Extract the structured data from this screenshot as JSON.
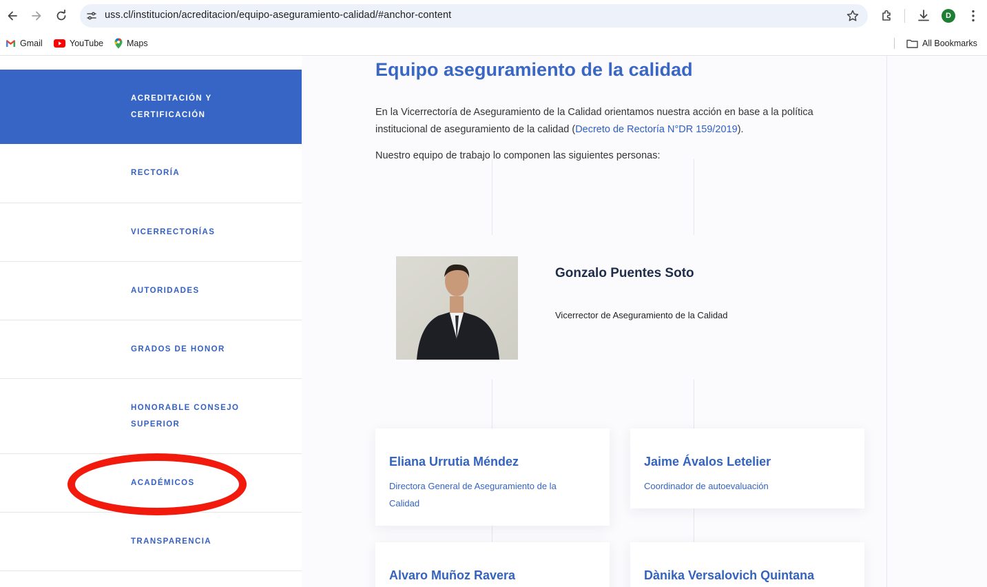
{
  "browser": {
    "url": "uss.cl/institucion/acreditacion/equipo-aseguramiento-calidad/#anchor-content",
    "profile_initial": "D",
    "bookmarks": [
      {
        "label": "Gmail",
        "icon": "gmail-icon"
      },
      {
        "label": "YouTube",
        "icon": "youtube-icon"
      },
      {
        "label": "Maps",
        "icon": "maps-icon"
      }
    ],
    "all_bookmarks_label": "All Bookmarks"
  },
  "sidebar": {
    "items": [
      {
        "label": "ACREDITACIÓN Y"
      },
      {
        "label": "CERTIFICACIÓN"
      },
      {
        "label": "RECTORÍA"
      },
      {
        "label": "VICERRECTORÍAS"
      },
      {
        "label": "AUTORIDADES"
      },
      {
        "label": "GRADOS DE HONOR"
      },
      {
        "label": "HONORABLE CONSEJO"
      },
      {
        "label": "SUPERIOR"
      },
      {
        "label": "ACADÉMICOS"
      },
      {
        "label": "TRANSPARENCIA"
      }
    ],
    "active_color": "#3665c5",
    "text_color": "#3561c2"
  },
  "main": {
    "title": "Equipo aseguramiento de la calidad",
    "intro_before_link": "En la Vicerrectoría de Aseguramiento de la Calidad orientamos nuestra acción en base a la política institucional de aseguramiento de la calidad (",
    "intro_link": "Decreto de Rectoría N°DR 159/2019",
    "intro_after_link": ").",
    "intro2": "Nuestro equipo de trabajo lo componen las siguientes personas:",
    "lead": {
      "name": "Gonzalo Puentes Soto",
      "role": "Vicerrector de Aseguramiento de la Calidad"
    },
    "team": [
      {
        "name": "Eliana Urrutia Méndez",
        "role": "Directora General de Aseguramiento de la Calidad"
      },
      {
        "name": "Jaime Ávalos Letelier",
        "role": "Coordinador de autoevaluación"
      },
      {
        "name": "Alvaro Muñoz Ravera",
        "role": ""
      },
      {
        "name": "Dànika Versalovich Quintana",
        "role": ""
      }
    ],
    "accent_color": "#3a67c4"
  },
  "annotation_color": "#f11a0d"
}
